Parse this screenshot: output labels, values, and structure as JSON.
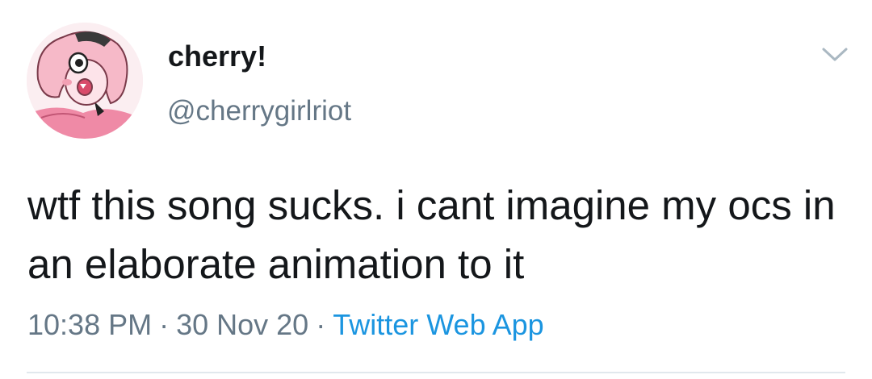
{
  "tweet": {
    "author": {
      "display_name": "cherry!",
      "handle": "@cherrygirlriot",
      "avatar_icon": "avatar-cartoon-girl"
    },
    "menu_icon": "chevron-down-icon",
    "text": "wtf this song sucks. i cant imagine my ocs in an elaborate animation to it",
    "time": "10:38 PM",
    "separator": "·",
    "date": "30 Nov 20",
    "source": "Twitter Web App"
  },
  "colors": {
    "text": "#14171a",
    "secondary": "#657786",
    "link": "#1b95e0",
    "divider": "#e1e8ed",
    "avatar_pink": "#f09bb0"
  }
}
